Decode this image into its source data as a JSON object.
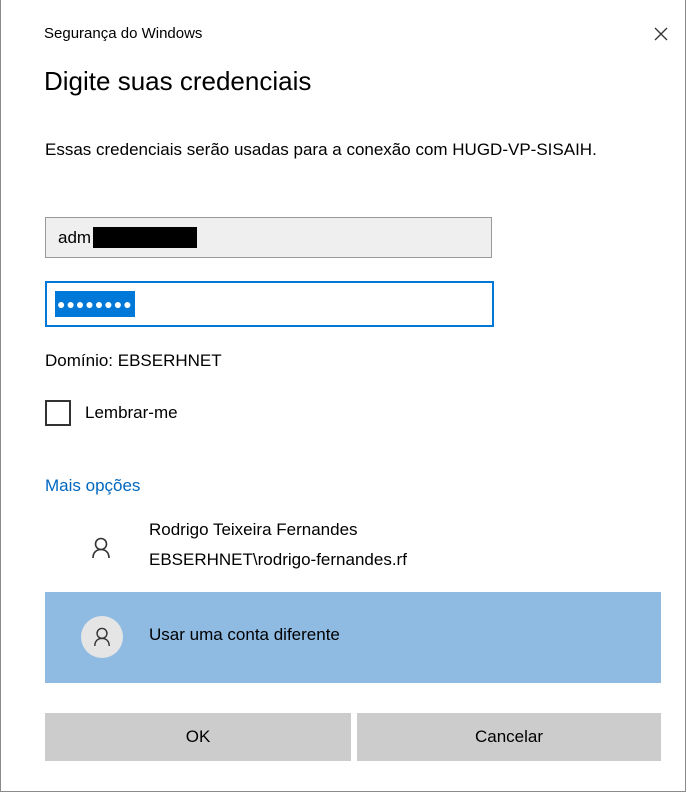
{
  "window": {
    "title": "Segurança do Windows"
  },
  "dialog": {
    "heading": "Digite suas credenciais",
    "description": "Essas credenciais serão usadas para a conexão com HUGD-VP-SISAIH.",
    "username_value": "adm",
    "password_mask": "●●●●●●●●",
    "domain_text": "Domínio: EBSERHNET",
    "remember_label": "Lembrar-me",
    "more_options": "Mais opções",
    "account": {
      "name": "Rodrigo Teixeira Fernandes",
      "user": "EBSERHNET\\rodrigo-fernandes.rf"
    },
    "different_account_label": "Usar uma conta diferente",
    "ok_label": "OK",
    "cancel_label": "Cancelar"
  },
  "colors": {
    "accent": "#0078d7",
    "link": "#0067c0",
    "selected_row": "#8fbbe3",
    "button": "#cccccc"
  },
  "icons": [
    "close-icon",
    "user-icon",
    "user-icon"
  ]
}
